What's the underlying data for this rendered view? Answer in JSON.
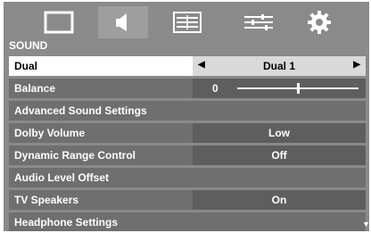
{
  "menu": {
    "tabs": [
      {
        "icon": "screen-icon",
        "selected": false
      },
      {
        "icon": "speaker-icon",
        "selected": true
      },
      {
        "icon": "list-settings-icon",
        "selected": false
      },
      {
        "icon": "sliders-icon",
        "selected": false
      },
      {
        "icon": "gear-icon",
        "selected": false
      }
    ],
    "section_title": "SOUND",
    "rows": [
      {
        "label": "Dual",
        "value": "Dual 1"
      },
      {
        "label": "Balance",
        "value": "0",
        "level": 0.5
      },
      {
        "label": "Advanced Sound Settings"
      },
      {
        "label": "Dolby Volume",
        "value": "Low"
      },
      {
        "label": "Dynamic Range Control",
        "value": "Off"
      },
      {
        "label": "Audio Level Offset"
      },
      {
        "label": "TV Speakers",
        "value": "On"
      },
      {
        "label": "Headphone Settings"
      }
    ]
  },
  "colors": {
    "background": "#8a8a8a",
    "row": "#6f6f6f",
    "row_value": "#5e5e5e",
    "row_active": "#ffffff",
    "row_active_value": "#d9d9d9"
  }
}
